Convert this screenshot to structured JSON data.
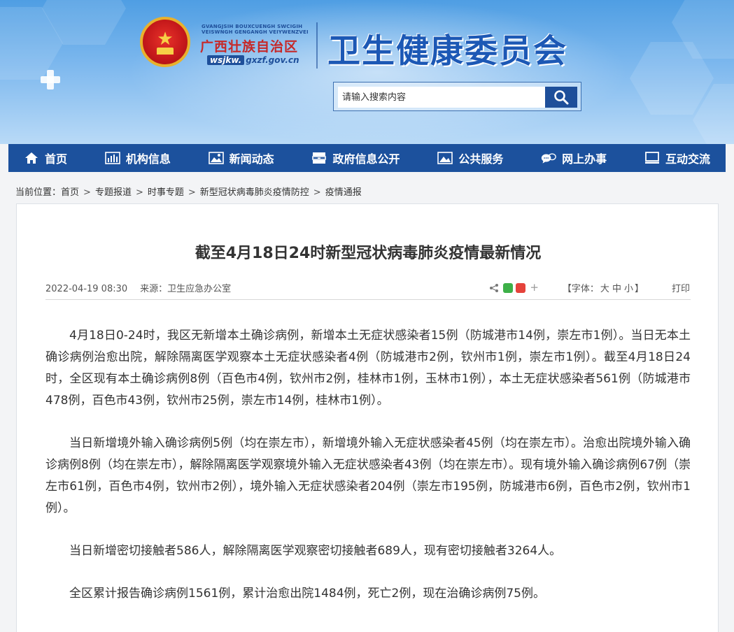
{
  "header": {
    "small_text_line1": "GVANGJSIH BOUXCUENGH SWCIGIH",
    "small_text_line2": "VEISWNGH GENGANGH VEIYWENZVEI",
    "region_name": "广西壮族自治区",
    "url_prefix": "wsjkw.",
    "url_suffix": "gxzf.gov.cn",
    "org_title": "卫生健康委员会",
    "emblem_icon": "national-emblem-icon"
  },
  "search": {
    "placeholder": "请输入搜索内容",
    "button_icon": "search-icon"
  },
  "nav": [
    {
      "label": "首页",
      "icon": "home-icon"
    },
    {
      "label": "机构信息",
      "icon": "bar-chart-icon"
    },
    {
      "label": "新闻动态",
      "icon": "image-icon"
    },
    {
      "label": "政府信息公开",
      "icon": "archive-icon"
    },
    {
      "label": "公共服务",
      "icon": "picture-icon"
    },
    {
      "label": "网上办事",
      "icon": "chat-icon"
    },
    {
      "label": "互动交流",
      "icon": "monitor-icon"
    }
  ],
  "breadcrumb": {
    "prefix": "当前位置：",
    "items": [
      "首页",
      "专题报道",
      "时事专题",
      "新型冠状病毒肺炎疫情防控",
      "疫情通报"
    ],
    "separator": ">"
  },
  "article": {
    "title": "截至4月18日24时新型冠状病毒肺炎疫情最新情况",
    "date": "2022-04-19 08:30",
    "source": "来源：卫生应急办公室",
    "font_label_prefix": "【字体：",
    "font_sizes": [
      "大",
      "中",
      "小"
    ],
    "font_label_suffix": "】",
    "print": "打印",
    "paragraphs": [
      "4月18日0-24时，我区无新增本土确诊病例，新增本土无症状感染者15例（防城港市14例，崇左市1例）。当日无本土确诊病例治愈出院，解除隔离医学观察本土无症状感染者4例（防城港市2例，钦州市1例，崇左市1例）。截至4月18日24时，全区现有本土确诊病例8例（百色市4例，钦州市2例，桂林市1例，玉林市1例），本土无症状感染者561例（防城港市478例，百色市43例，钦州市25例，崇左市14例，桂林市1例）。",
      "当日新增境外输入确诊病例5例（均在崇左市），新增境外输入无症状感染者45例（均在崇左市）。治愈出院境外输入确诊病例8例（均在崇左市），解除隔离医学观察境外输入无症状感染者43例（均在崇左市）。现有境外输入确诊病例67例（崇左市61例，百色市4例，钦州市2例），境外输入无症状感染者204例（崇左市195例，防城港市6例，百色市2例，钦州市1例）。",
      "当日新增密切接触者586人，解除隔离医学观察密切接触者689人，现有密切接触者3264人。",
      "全区累计报告确诊病例1561例，累计治愈出院1484例，死亡2例，现在治确诊病例75例。"
    ]
  },
  "colors": {
    "nav_bg": "#1c519d",
    "title_blue": "#1c58b5",
    "region_red": "#c62828"
  }
}
